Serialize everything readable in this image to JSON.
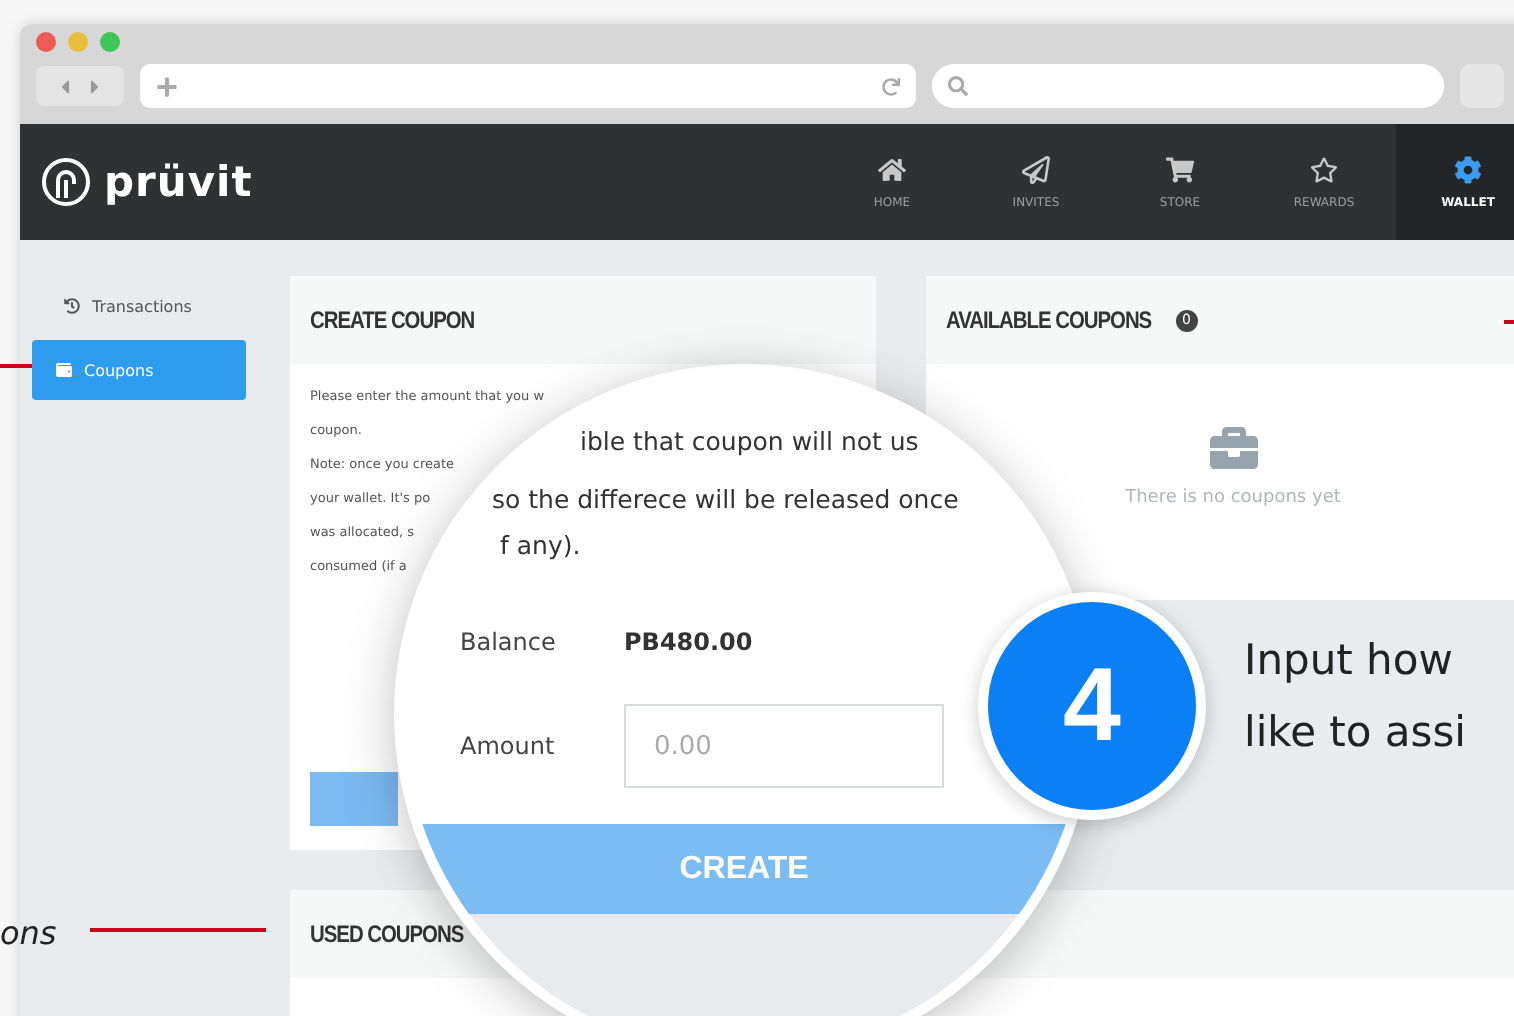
{
  "nav": {
    "logo": "prüvit",
    "items": [
      {
        "label": "HOME",
        "kind": "home",
        "selected": false
      },
      {
        "label": "INVITES",
        "kind": "plane",
        "selected": false
      },
      {
        "label": "STORE",
        "kind": "cart",
        "selected": false
      },
      {
        "label": "REWARDS",
        "kind": "star",
        "selected": false
      },
      {
        "label": "WALLET",
        "kind": "gear",
        "selected": true
      }
    ]
  },
  "sidebar": {
    "items": [
      {
        "label": "Transactions",
        "kind": "history",
        "selected": false
      },
      {
        "label": "Coupons",
        "kind": "wallet",
        "selected": true
      }
    ]
  },
  "create_card": {
    "title": "CREATE COUPON",
    "lines": [
      "Please enter the amount that you w",
      "coupon.",
      "Note: once you create",
      "your wallet. It's po",
      "was allocated, s",
      "consumed (if a"
    ]
  },
  "available_card": {
    "title": "AVAILABLE COUPONS",
    "count": "0",
    "empty_text": "There is no coupons yet"
  },
  "used_card": {
    "title": "USED COUPONS"
  },
  "magnifier": {
    "lines": [
      "ible that coupon will not us",
      "so the differece will be released once",
      "f any)."
    ],
    "balance_label": "Balance",
    "balance_value": "PB480.00",
    "amount_label": "Amount",
    "amount_placeholder": "0.00",
    "button": "CREATE"
  },
  "step": {
    "number": "4",
    "lines": [
      "Input how",
      "like to assi"
    ]
  },
  "side_annotation": "ons"
}
